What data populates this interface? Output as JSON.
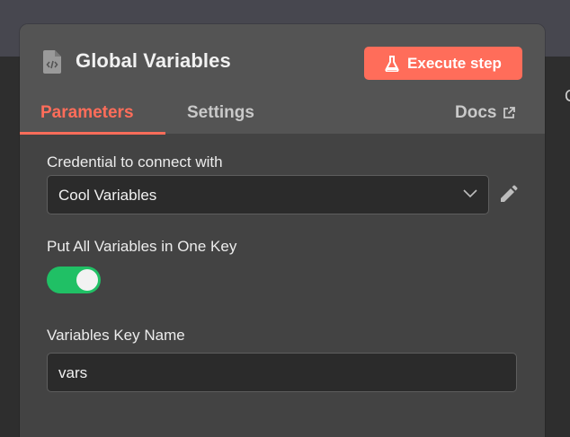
{
  "panel": {
    "title": "Global Variables",
    "node_icon": "code-file-icon",
    "execute_button": {
      "label": "Execute step",
      "icon": "flask-icon",
      "color": "#ff6d5a"
    }
  },
  "tabs": [
    {
      "label": "Parameters",
      "active": true
    },
    {
      "label": "Settings",
      "active": false
    },
    {
      "label": "Docs",
      "icon": "external-link-icon"
    }
  ],
  "form": {
    "credential": {
      "label": "Credential to connect with",
      "value": "Cool Variables",
      "dropdown_icon": "chevron-down-icon",
      "edit_icon": "pencil-icon"
    },
    "one_key": {
      "label": "Put All Variables in One Key",
      "enabled": true,
      "color": "#20c065"
    },
    "key_name": {
      "label": "Variables Key Name",
      "value": "vars"
    }
  }
}
